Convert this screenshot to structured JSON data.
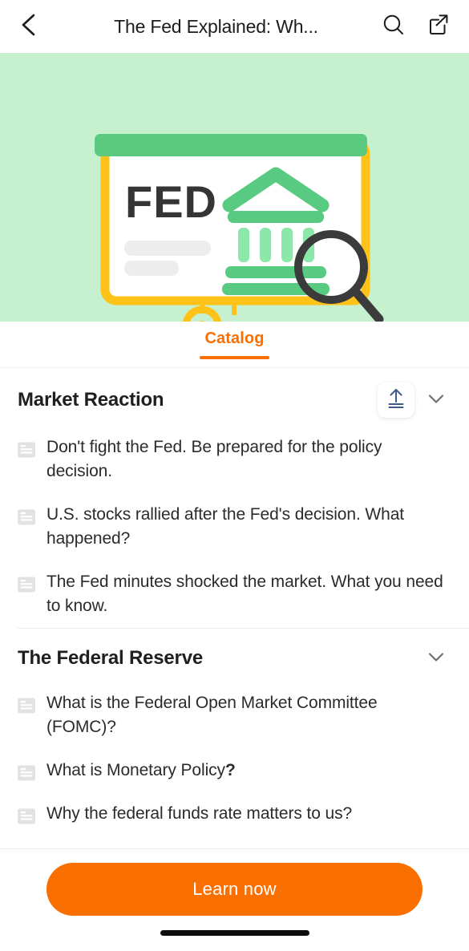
{
  "header": {
    "back_icon": "chevron-left-icon",
    "title": "The Fed Explained: Wh...",
    "search_icon": "search-icon",
    "share_icon": "share-icon"
  },
  "hero": {
    "board_text": "FED",
    "bg_color": "#c6f0ce",
    "frame_color": "#ffc219",
    "header_bar_color": "#5bc97f",
    "bank_icon": "bank-icon",
    "magnifier_icon": "magnifier-icon"
  },
  "tabs": [
    {
      "label": "Catalog",
      "active": true,
      "color": "#fa7000"
    }
  ],
  "sections": [
    {
      "title": "Market Reaction",
      "collapse_all_icon": "collapse-all-icon",
      "chevron_icon": "chevron-down-icon",
      "items": [
        {
          "icon": "article-icon",
          "text": "Don't fight the Fed. Be prepared for the policy decision."
        },
        {
          "icon": "article-icon",
          "text": "U.S. stocks rallied after the Fed's decision. What happened?"
        },
        {
          "icon": "article-icon",
          "text": "The Fed minutes shocked the market. What you need to know."
        }
      ]
    },
    {
      "title": "The Federal Reserve",
      "chevron_icon": "chevron-down-icon",
      "items": [
        {
          "icon": "article-icon",
          "text": "What is the Federal Open Market Committee (FOMC)?"
        },
        {
          "icon": "article-icon",
          "text_prefix": "What is Monetary Policy",
          "text_suffix": "?"
        },
        {
          "icon": "article-icon",
          "text": "Why the federal funds rate matters to us?"
        }
      ]
    }
  ],
  "bottom": {
    "cta_label": "Learn now",
    "cta_color": "#fa7000",
    "home_indicator": "home-indicator"
  }
}
